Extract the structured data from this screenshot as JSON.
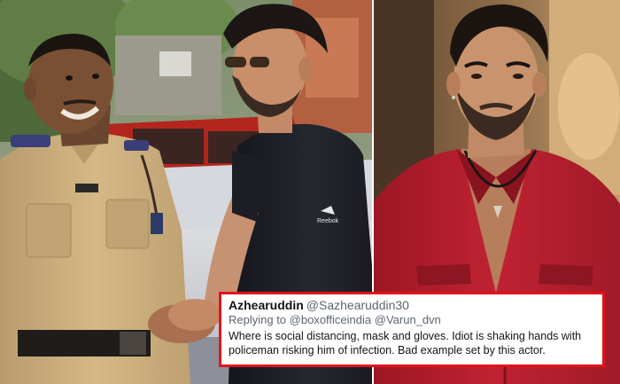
{
  "tweet": {
    "author_name": "Azhearuddin",
    "author_handle": "@Sazhearuddin30",
    "reply_prefix": "Replying to",
    "reply_to_1": "@boxofficeindia",
    "reply_to_2": "@Varun_dvn",
    "text": "Where is social distancing, mask and gloves. Idiot is shaking hands with policeman risking him of infection. Bad example set by this actor."
  },
  "photo_left": {
    "tshirt_brand": "Reebok"
  },
  "colors": {
    "tweet_border": "#e1141c",
    "police_uniform": "#c9ac7d",
    "red_shirt": "#b71e2a",
    "black_tshirt": "#1b1c20"
  }
}
